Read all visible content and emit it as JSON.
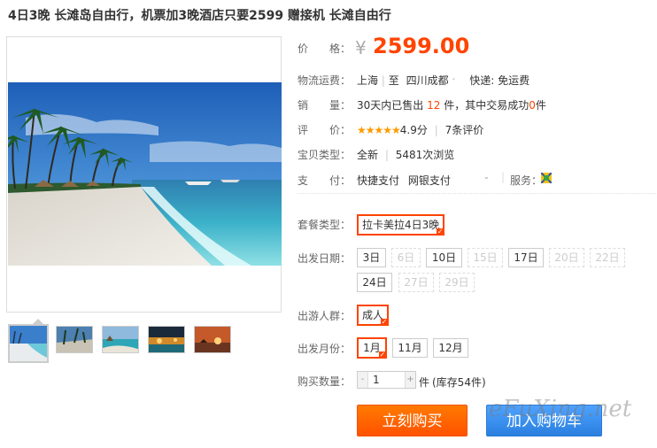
{
  "title": "4日3晚 长滩岛自由行，机票加3晚酒店只要2599 赠接机 长滩自由行",
  "price": {
    "label": "价　　格：",
    "currency": "¥",
    "amount": "2599.00"
  },
  "shipping": {
    "label": "物流运费：",
    "from": "上海",
    "to_prefix": "至",
    "to": "四川成都",
    "caret": "ˇ",
    "express": "快递: 免运费"
  },
  "sales": {
    "label": "销　　量：",
    "prefix": "30天内已售出",
    "count": "12",
    "mid": "件，其中交易成功",
    "success": "0",
    "suffix": "件"
  },
  "rating": {
    "label": "评　　价：",
    "stars": "★★★★★",
    "score": "4.9分",
    "reviews": "7条评价"
  },
  "item_type": {
    "label": "宝贝类型：",
    "condition": "全新",
    "views": "5481次浏览"
  },
  "payment": {
    "label": "支　　付：",
    "method1": "快捷支付",
    "method2": "网银支付",
    "service_label": "服务："
  },
  "package": {
    "label": "套餐类型：",
    "options": [
      "拉卡美拉4日3晚"
    ]
  },
  "dates": {
    "label": "出发日期：",
    "options": [
      "3日",
      "6日",
      "10日",
      "15日",
      "17日",
      "20日",
      "22日",
      "24日",
      "27日",
      "29日"
    ]
  },
  "group": {
    "label": "出游人群：",
    "options": [
      "成人"
    ]
  },
  "months": {
    "label": "出发月份：",
    "options": [
      "1月",
      "11月",
      "12月"
    ]
  },
  "quantity": {
    "label": "购买数量：",
    "minus": "-",
    "value": "1",
    "plus": "+",
    "unit": "件",
    "stock": "(库存54件)"
  },
  "buttons": {
    "buy_now": "立刻购买",
    "add_to_cart": "加入购物车"
  },
  "watermark": "eFuXing.net",
  "colors": {
    "accent": "#ff4400",
    "buy_button": "#ff6600",
    "cart_button": "#3a8ff0",
    "star": "#ff9900"
  }
}
